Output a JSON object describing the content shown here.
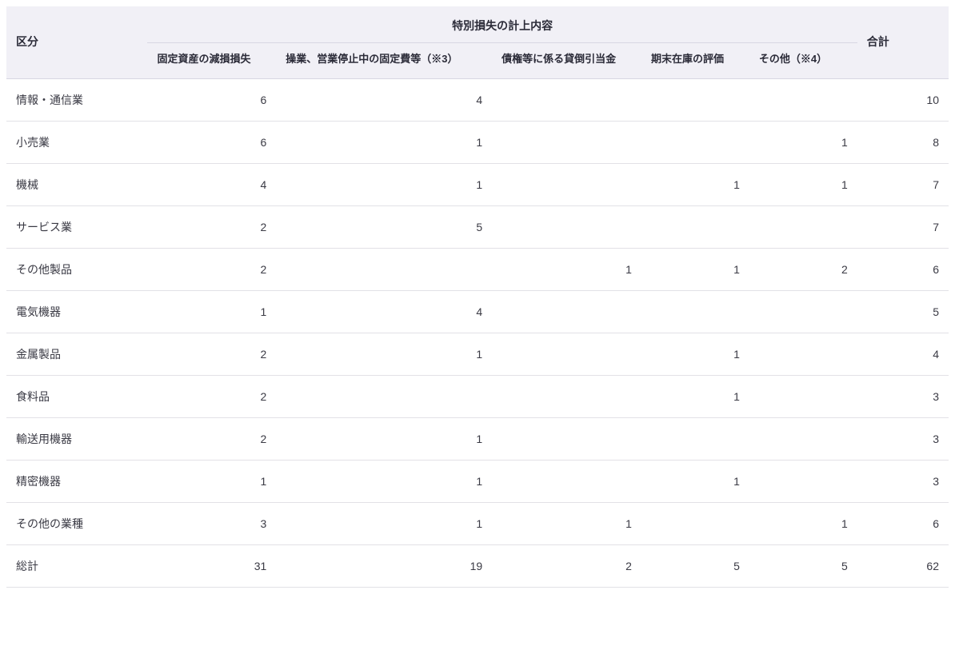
{
  "header": {
    "category": "区分",
    "group": "特別損失の計上内容",
    "total": "合計",
    "sub": [
      "固定資産の減損損失",
      "操業、営業停止中の固定費等（※3）",
      "債権等に係る貸倒引当金",
      "期末在庫の評価",
      "その他（※4）"
    ]
  },
  "rows": [
    {
      "label": "情報・通信業",
      "v": [
        "6",
        "4",
        "",
        "",
        ""
      ],
      "total": "10"
    },
    {
      "label": "小売業",
      "v": [
        "6",
        "1",
        "",
        "",
        "1"
      ],
      "total": "8"
    },
    {
      "label": "機械",
      "v": [
        "4",
        "1",
        "",
        "1",
        "1"
      ],
      "total": "7"
    },
    {
      "label": "サービス業",
      "v": [
        "2",
        "5",
        "",
        "",
        ""
      ],
      "total": "7"
    },
    {
      "label": "その他製品",
      "v": [
        "2",
        "",
        "1",
        "1",
        "2"
      ],
      "total": "6"
    },
    {
      "label": "電気機器",
      "v": [
        "1",
        "4",
        "",
        "",
        ""
      ],
      "total": "5"
    },
    {
      "label": "金属製品",
      "v": [
        "2",
        "1",
        "",
        "1",
        ""
      ],
      "total": "4"
    },
    {
      "label": "食料品",
      "v": [
        "2",
        "",
        "",
        "1",
        ""
      ],
      "total": "3"
    },
    {
      "label": "輸送用機器",
      "v": [
        "2",
        "1",
        "",
        "",
        ""
      ],
      "total": "3"
    },
    {
      "label": "精密機器",
      "v": [
        "1",
        "1",
        "",
        "1",
        ""
      ],
      "total": "3"
    },
    {
      "label": "その他の業種",
      "v": [
        "3",
        "1",
        "1",
        "",
        "1"
      ],
      "total": "6"
    },
    {
      "label": "総計",
      "v": [
        "31",
        "19",
        "2",
        "5",
        "5"
      ],
      "total": "62"
    }
  ],
  "chart_data": {
    "type": "table",
    "title": "特別損失の計上内容",
    "columns": [
      "区分",
      "固定資産の減損損失",
      "操業、営業停止中の固定費等（※3）",
      "債権等に係る貸倒引当金",
      "期末在庫の評価",
      "その他（※4）",
      "合計"
    ],
    "rows": [
      [
        "情報・通信業",
        6,
        4,
        null,
        null,
        null,
        10
      ],
      [
        "小売業",
        6,
        1,
        null,
        null,
        1,
        8
      ],
      [
        "機械",
        4,
        1,
        null,
        1,
        1,
        7
      ],
      [
        "サービス業",
        2,
        5,
        null,
        null,
        null,
        7
      ],
      [
        "その他製品",
        2,
        null,
        1,
        1,
        2,
        6
      ],
      [
        "電気機器",
        1,
        4,
        null,
        null,
        null,
        5
      ],
      [
        "金属製品",
        2,
        1,
        null,
        1,
        null,
        4
      ],
      [
        "食料品",
        2,
        null,
        null,
        1,
        null,
        3
      ],
      [
        "輸送用機器",
        2,
        1,
        null,
        null,
        null,
        3
      ],
      [
        "精密機器",
        1,
        1,
        null,
        1,
        null,
        3
      ],
      [
        "その他の業種",
        3,
        1,
        1,
        null,
        1,
        6
      ],
      [
        "総計",
        31,
        19,
        2,
        5,
        5,
        62
      ]
    ]
  }
}
